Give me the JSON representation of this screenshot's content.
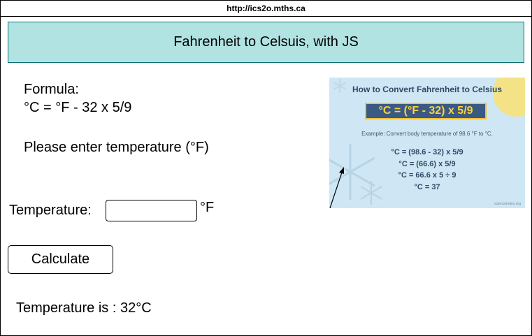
{
  "browser": {
    "url": "http://ics2o.mths.ca"
  },
  "header": {
    "title": "Fahrenheit to Celsuis, with JS"
  },
  "formula": {
    "label": "Formula:",
    "text": "°C = °F - 32 x 5/9"
  },
  "instructions": "Please enter temperature (°F)",
  "form": {
    "label": "Temperature:",
    "input_value": "",
    "placeholder": "",
    "unit": "°F",
    "button_label": "Calculate"
  },
  "result": "Temperature is : 32°C",
  "infographic": {
    "title": "How to Convert Fahrenheit to Celsius",
    "formula": "°C = (°F - 32)  x  5/9",
    "example": "Example: Convert body temperature of 98.6 °F to °C.",
    "steps": [
      "°C = (98.6 - 32)  x  5/9",
      "°C = (66.6) x 5/9",
      "°C = 66.6 x 5 ÷ 9",
      "°C = 37"
    ],
    "source": "sciencenotes.org"
  }
}
